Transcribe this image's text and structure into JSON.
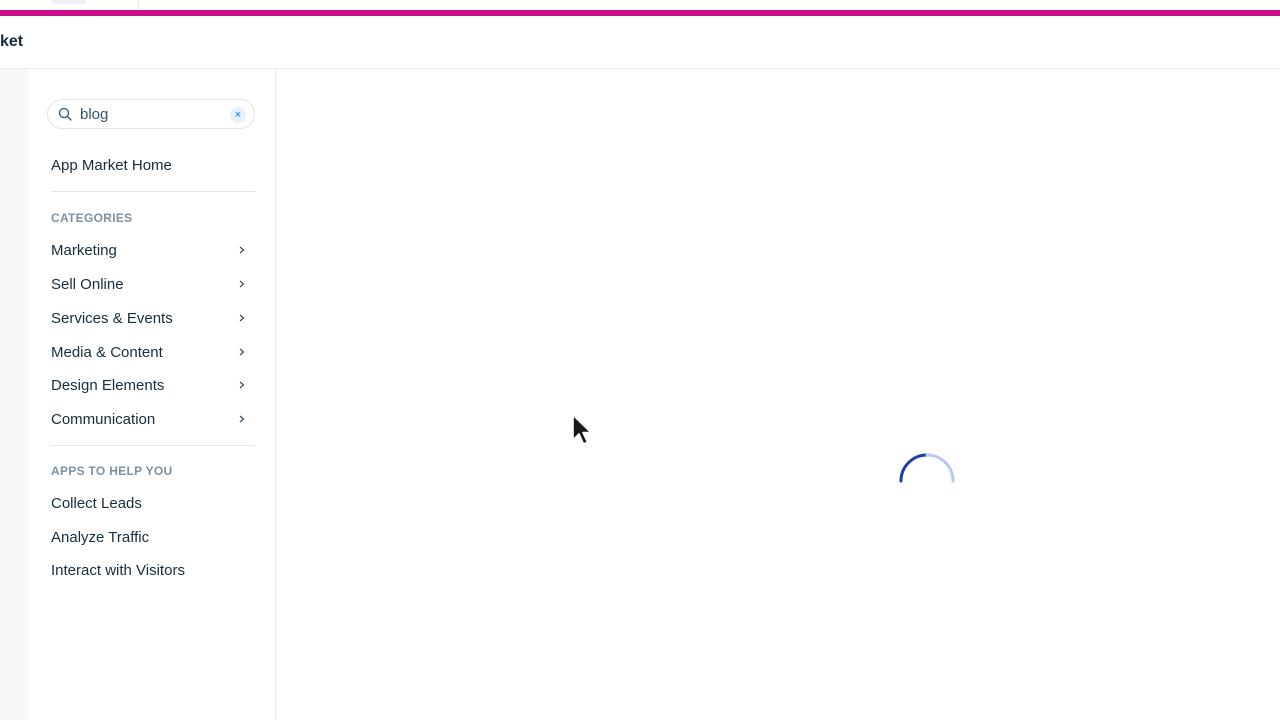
{
  "header": {
    "title": "ket"
  },
  "search": {
    "value": "blog",
    "placeholder": "",
    "clear_glyph": "×"
  },
  "sidebar": {
    "home_label": "App Market Home",
    "categories_heading": "CATEGORIES",
    "categories": [
      {
        "label": "Marketing"
      },
      {
        "label": "Sell Online"
      },
      {
        "label": "Services & Events"
      },
      {
        "label": "Media & Content"
      },
      {
        "label": "Design Elements"
      },
      {
        "label": "Communication"
      }
    ],
    "help_heading": "APPS TO HELP YOU",
    "help_items": [
      {
        "label": "Collect Leads"
      },
      {
        "label": "Analyze Traffic"
      },
      {
        "label": "Interact with Visitors"
      }
    ]
  },
  "icons": {
    "search": "search-icon",
    "clear": "close-icon",
    "chevron": "chevron-right-icon",
    "spinner": "loading-spinner-icon",
    "cursor": "mouse-pointer-icon"
  },
  "colors": {
    "accent_bar": "#c8118a",
    "link_blue": "#116dff",
    "spinner": "#1a3fa8",
    "text": "#162d3d",
    "muted": "#7a92a5"
  }
}
